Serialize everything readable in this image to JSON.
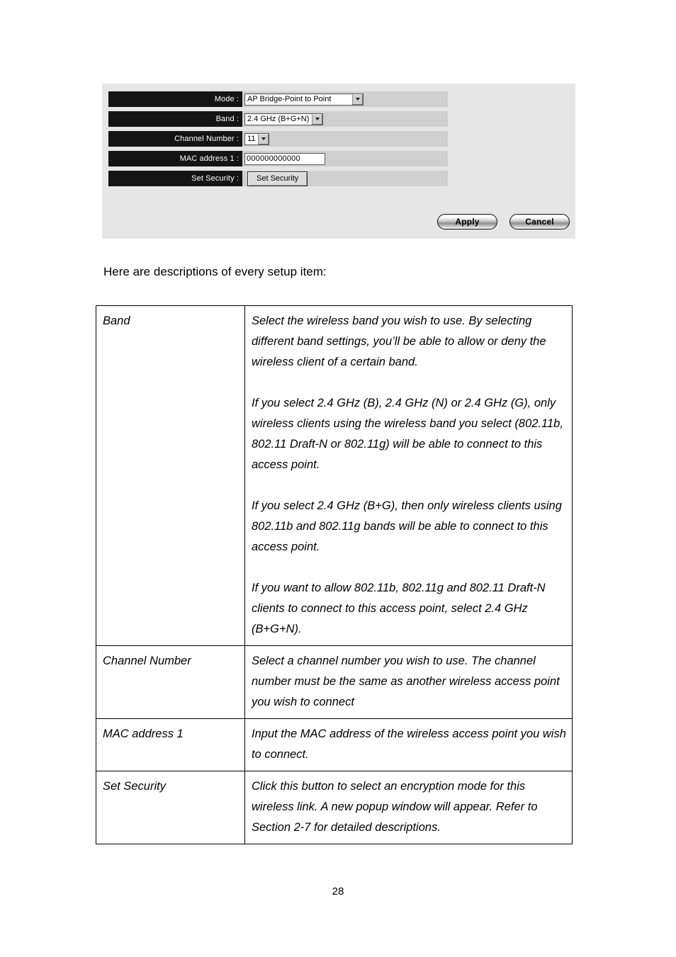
{
  "screenshot": {
    "form": {
      "rows": [
        {
          "label": "Mode :",
          "control": "select",
          "value": "AP Bridge-Point to Point",
          "wide": true
        },
        {
          "label": "Band :",
          "control": "select",
          "value": "2.4 GHz (B+G+N)",
          "wide": false
        },
        {
          "label": "Channel Number :",
          "control": "select",
          "value": "11",
          "wide": false
        },
        {
          "label": "MAC address 1 :",
          "control": "input",
          "value": "000000000000",
          "wide": false
        },
        {
          "label": "Set Security :",
          "control": "button",
          "value": "Set Security",
          "wide": false
        }
      ]
    },
    "actions": {
      "apply_label": "Apply",
      "cancel_label": "Cancel"
    },
    "colors": {
      "panel_bg": "#e6e6e6",
      "row_strip": "#cfcfcf",
      "label_bar": "#141414",
      "label_text": "#ffffff"
    }
  },
  "intro": "Here are descriptions of every setup item:",
  "descriptions": {
    "rows": [
      {
        "term": "Band",
        "paragraphs": [
          "Select the wireless band you wish to use. By selecting different band settings, you’ll be able to allow or deny the wireless client of a certain band.",
          "If you select 2.4 GHz (B), 2.4 GHz (N) or 2.4 GHz (G), only wireless clients using the wireless band you select (802.11b, 802.11 Draft-N or 802.11g) will be able to connect to this access point.",
          "If you select 2.4 GHz (B+G), then only wireless clients using 802.11b and 802.11g bands will be able to connect to this access point.",
          "If you want to allow 802.11b, 802.11g and 802.11 Draft-N clients to connect to this access point, select 2.4 GHz (B+G+N)."
        ]
      },
      {
        "term": "Channel Number",
        "paragraphs": [
          "Select a channel number you wish to use. The channel number must be the same as another wireless access point you wish to connect"
        ]
      },
      {
        "term": "MAC address 1",
        "paragraphs": [
          "Input the MAC address of the wireless access point you wish to connect."
        ]
      },
      {
        "term": "Set Security",
        "paragraphs": [
          "Click this button to select an encryption mode for this wireless link. A new popup window will appear. Refer to Section 2-7 for detailed descriptions."
        ]
      }
    ]
  },
  "footer": {
    "page_number": "28"
  }
}
